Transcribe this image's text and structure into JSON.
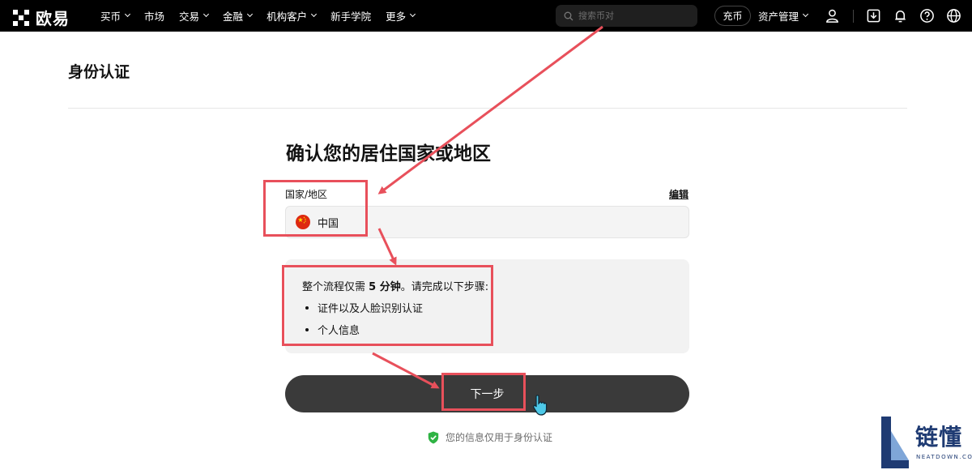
{
  "header": {
    "logo_text": "欧易",
    "nav": [
      {
        "label": "买币",
        "has_menu": true
      },
      {
        "label": "市场",
        "has_menu": false
      },
      {
        "label": "交易",
        "has_menu": true
      },
      {
        "label": "金融",
        "has_menu": true
      },
      {
        "label": "机构客户",
        "has_menu": true
      },
      {
        "label": "新手学院",
        "has_menu": false
      },
      {
        "label": "更多",
        "has_menu": true
      }
    ],
    "search_placeholder": "搜索币对",
    "deposit_label": "充币",
    "asset_menu_label": "资产管理",
    "icons": [
      "user-icon",
      "download-icon",
      "bell-icon",
      "help-icon",
      "globe-icon"
    ]
  },
  "page": {
    "title": "身份认证",
    "heading": "确认您的居住国家或地区",
    "country_label": "国家/地区",
    "edit_label": "编辑",
    "country_value": "中国",
    "info": {
      "intro_prefix": "整个流程仅需 ",
      "intro_bold": "5 分钟",
      "intro_suffix": "。请完成以下步骤:",
      "steps": [
        "证件以及人脸识别认证",
        "个人信息"
      ]
    },
    "next_button": "下一步",
    "privacy_note": "您的信息仅用于身份认证"
  },
  "watermark": {
    "text": "链懂",
    "sub": "NEATDOWN.COM"
  },
  "colors": {
    "topbar": "#000000",
    "primary_button": "#3a3a3a",
    "annotation": "#e8505b",
    "shield": "#2fb344",
    "flag": "#de2910"
  }
}
